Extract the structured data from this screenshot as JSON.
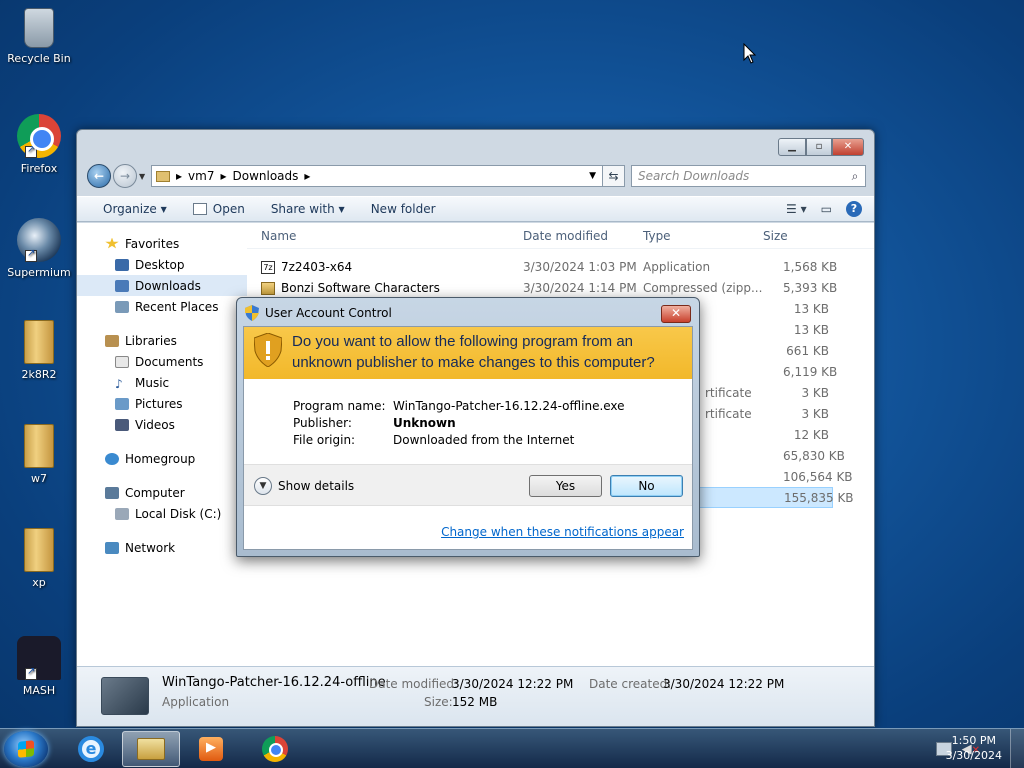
{
  "desktop": {
    "icons": [
      {
        "label": "Recycle Bin"
      },
      {
        "label": "Firefox"
      },
      {
        "label": "Supermium"
      },
      {
        "label": "2k8R2"
      },
      {
        "label": "w7"
      },
      {
        "label": "xp"
      },
      {
        "label": "MASH"
      }
    ]
  },
  "explorer": {
    "address": {
      "root": "vm7",
      "folder": "Downloads"
    },
    "search_placeholder": "Search Downloads",
    "toolbar": {
      "organize": "Organize",
      "open": "Open",
      "share_with": "Share with",
      "new_folder": "New folder"
    },
    "nav": {
      "favorites": "Favorites",
      "desktop": "Desktop",
      "downloads": "Downloads",
      "recent_places": "Recent Places",
      "libraries": "Libraries",
      "documents": "Documents",
      "music": "Music",
      "pictures": "Pictures",
      "videos": "Videos",
      "homegroup": "Homegroup",
      "computer": "Computer",
      "local_disk": "Local Disk (C:)",
      "network": "Network"
    },
    "columns": {
      "name": "Name",
      "date": "Date modified",
      "type": "Type",
      "size": "Size"
    },
    "files": [
      {
        "name": "7z2403-x64",
        "date": "3/30/2024 1:03 PM",
        "type": "Application",
        "size": "1,568 KB"
      },
      {
        "name": "Bonzi Software Characters",
        "date": "3/30/2024 1:14 PM",
        "type": "Compressed (zipp...",
        "size": "5,393 KB"
      },
      {
        "name": "",
        "date": "",
        "type": "",
        "size": "13 KB"
      },
      {
        "name": "",
        "date": "",
        "type": "",
        "size": "13 KB"
      },
      {
        "name": "",
        "date": "",
        "type": "",
        "size": "661 KB"
      },
      {
        "name": "",
        "date": "",
        "type": "",
        "size": "6,119 KB"
      },
      {
        "name": "",
        "date": "",
        "type": "rtificate",
        "size": "3 KB"
      },
      {
        "name": "",
        "date": "",
        "type": "rtificate",
        "size": "3 KB"
      },
      {
        "name": "",
        "date": "",
        "type": "",
        "size": "12 KB"
      },
      {
        "name": "",
        "date": "",
        "type": "",
        "size": "65,830 KB"
      },
      {
        "name": "",
        "date": "",
        "type": "",
        "size": "106,564 KB"
      },
      {
        "name": "",
        "date": "",
        "type": "",
        "size": "155,835 KB"
      }
    ],
    "details": {
      "name": "WinTango-Patcher-16.12.24-offline",
      "kind": "Application",
      "modified_label": "Date modified:",
      "modified_value": "3/30/2024 12:22 PM",
      "created_label": "Date created:",
      "created_value": "3/30/2024 12:22 PM",
      "size_label": "Size:",
      "size_value": "152 MB"
    }
  },
  "uac": {
    "title": "User Account Control",
    "question": "Do you want to allow the following program from an unknown publisher to make changes to this computer?",
    "program_name_label": "Program name:",
    "program_name": "WinTango-Patcher-16.12.24-offline.exe",
    "publisher_label": "Publisher:",
    "publisher": "Unknown",
    "file_origin_label": "File origin:",
    "file_origin": "Downloaded from the Internet",
    "show_details": "Show details",
    "yes": "Yes",
    "no": "No",
    "link": "Change when these notifications appear"
  },
  "taskbar": {
    "time": "1:50 PM",
    "date": "3/30/2024"
  }
}
